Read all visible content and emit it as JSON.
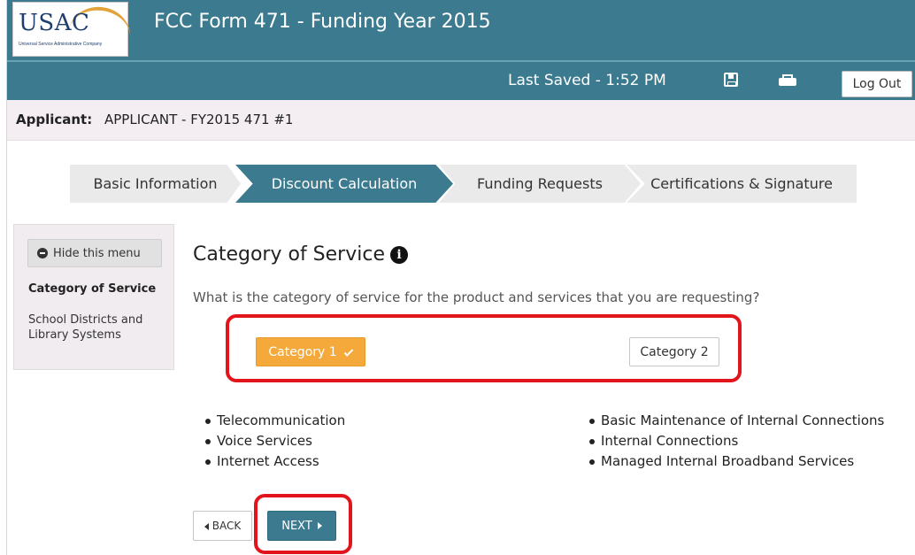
{
  "header": {
    "logo_text": "USAC",
    "logo_subtitle": "Universal Service Administrative Company",
    "form_title": "FCC Form 471 - Funding Year 2015",
    "last_saved": "Last Saved - 1:52 PM",
    "logout_label": "Log Out",
    "icons": [
      "save-icon",
      "print-icon"
    ]
  },
  "applicant": {
    "label": "Applicant:",
    "value": "APPLICANT - FY2015 471 #1"
  },
  "steps": [
    {
      "label": "Basic Information",
      "state": "inactive"
    },
    {
      "label": "Discount Calculation",
      "state": "active"
    },
    {
      "label": "Funding Requests",
      "state": "inactive"
    },
    {
      "label": "Certifications & Signature",
      "state": "inactive"
    }
  ],
  "sidebar": {
    "hide_menu_label": "Hide this menu",
    "items": [
      {
        "label": "Category of Service",
        "selected": true
      },
      {
        "label": "School Districts and Library Systems",
        "selected": false
      }
    ]
  },
  "main": {
    "title": "Category of Service",
    "question": "What is the category of service for the product and services that you are requesting?",
    "category1_label": "Category 1",
    "category2_label": "Category 2",
    "category1_services": [
      "Telecommunication",
      "Voice Services",
      "Internet Access"
    ],
    "category2_services": [
      "Basic Maintenance of Internal Connections",
      "Internal Connections",
      "Managed Internal Broadband Services"
    ],
    "back_label": "BACK",
    "next_label": "NEXT"
  },
  "colors": {
    "brand": "#3b7a8f",
    "selected_category": "#f4a93a",
    "highlight": "#e2151c"
  }
}
